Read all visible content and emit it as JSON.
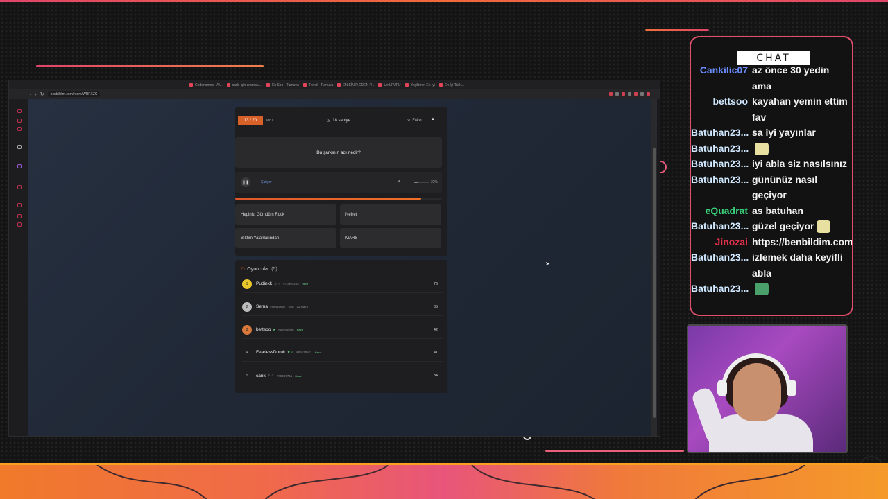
{
  "browser": {
    "tabs": [
      "Codenames - Al...",
      "sarki için arama u...",
      "Ek Son - Turnuva",
      "Trend - Turnuva",
      "EN SİNİR EDEN P...",
      "UwUFUFU",
      "Yeşiltirnet En İyi",
      "En İyi Türk..."
    ],
    "url": "benbildim.com/room/WRFXZC"
  },
  "quiz": {
    "counter": "13 / 20",
    "counter_suffix": "soru",
    "timer": "18 saniye",
    "role": "Patron",
    "question": "Bu şarkının adı nedir?",
    "player_status": "Çalıyor",
    "volume": "22%",
    "volume_level": 0.22,
    "progress": 0.9,
    "answers": [
      "Hepinizi Gömdüm Rock",
      "Nefret",
      "Bıktım Yalanlarından",
      "MARS"
    ]
  },
  "players": {
    "title": "Oyuncular",
    "count": "(5)",
    "list": [
      {
        "rank": "1",
        "name": "Pudinkk",
        "code": "#7b8e4244",
        "status": "Hazır",
        "score": "76",
        "color": "#e8c82a"
      },
      {
        "rank": "2",
        "name": "Sema",
        "code": "#8644e667",
        "status": "Son",
        "extra": "11 Hazır",
        "score": "65",
        "color": "#bbbbbb"
      },
      {
        "rank": "3",
        "name": "bettsoo",
        "code": "#54e5ed86",
        "status": "Hazır",
        "score": "42",
        "color": "#d8783a"
      },
      {
        "rank": "4",
        "name": "FearlessDoruk",
        "code": "#86578a21",
        "status": "Hazır",
        "score": "41",
        "color": "transparent"
      },
      {
        "rank": "5",
        "name": "cank",
        "code": "#7894771a",
        "status": "Hazır",
        "score": "34",
        "color": "transparent"
      }
    ]
  },
  "chat": {
    "header": "CHAT",
    "messages": [
      {
        "user": "Cankilic07",
        "msg": "az önce 30 yedin ama",
        "color": "#6b8cff"
      },
      {
        "user": "bettsoo",
        "msg": "kayahan yemin ettim fav",
        "color": "#cfe8ff"
      },
      {
        "user": "Batuhan23...",
        "msg": "sa iyi yayınlar",
        "color": "#cfe8ff"
      },
      {
        "user": "Batuhan23...",
        "msg": "",
        "emote": "#e8e0a0",
        "color": "#cfe8ff"
      },
      {
        "user": "Batuhan23...",
        "msg": "iyi abla siz nasılsınız",
        "color": "#cfe8ff"
      },
      {
        "user": "Batuhan23...",
        "msg": "gününüz nasıl geçiyor",
        "color": "#cfe8ff"
      },
      {
        "user": "eQuadrat",
        "msg": "as batuhan",
        "color": "#3ad07a"
      },
      {
        "user": "Batuhan23...",
        "msg": "güzel geçiyor",
        "emote": "#e8e0a0",
        "color": "#cfe8ff"
      },
      {
        "user": "Jinozai",
        "msg": "https://benbildim.com/room/WRFXZC",
        "color": "#e0304a"
      },
      {
        "user": "Batuhan23...",
        "msg": "izlemek daha keyifli abla",
        "color": "#cfe8ff"
      },
      {
        "user": "Batuhan23...",
        "msg": "",
        "emote": "#4aa06a",
        "color": "#cfe8ff"
      }
    ]
  }
}
